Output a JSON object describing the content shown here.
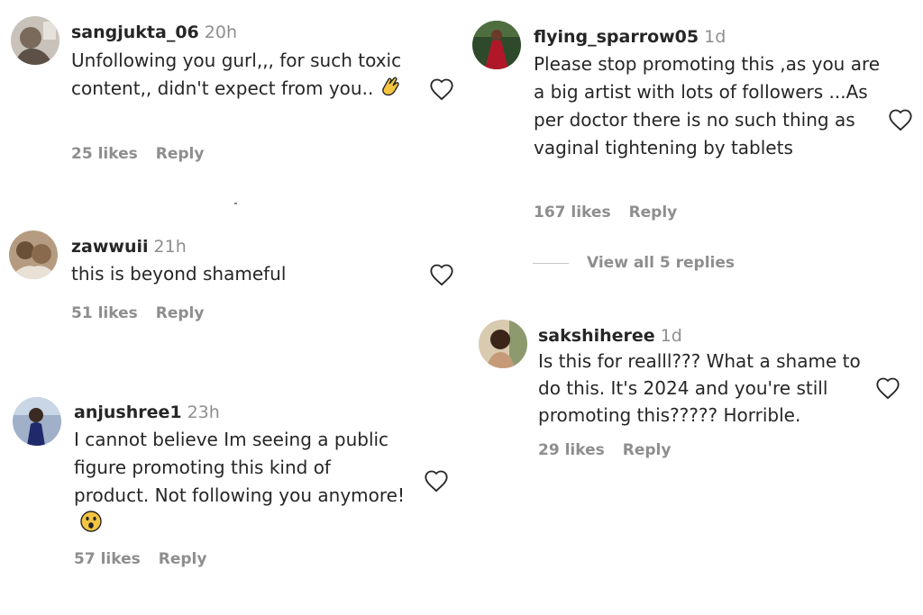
{
  "comments": [
    {
      "username": "sangjukta_06",
      "time": "20h",
      "text": "Unfollowing you gurl,,, for such toxic content,, didn't expect from you..",
      "emoji": "clapping-hands-icon",
      "likes": "25 likes",
      "reply": "Reply"
    },
    {
      "username": "zawwuii",
      "time": "21h",
      "text": "this is beyond shameful",
      "likes": "51 likes",
      "reply": "Reply"
    },
    {
      "username": "anjushree1",
      "time": "23h",
      "text": "I cannot believe Im seeing a public figure promoting this kind of product. Not following you anymore!",
      "emoji": "astonished-face-icon",
      "likes": "57 likes",
      "reply": "Reply"
    },
    {
      "username": "flying_sparrow05",
      "time": "1d",
      "text": "Please stop promoting this ,as you are a big artist with lots of followers ...As per doctor there is no such thing as vaginal tightening by tablets",
      "likes": "167 likes",
      "reply": "Reply",
      "view_replies": "View all 5 replies"
    },
    {
      "username": "sakshiheree",
      "time": "1d",
      "text": "Is this for realll??? What a shame to do this. It's 2024 and you're still promoting this????? Horrible.",
      "likes": "29 likes",
      "reply": "Reply"
    }
  ],
  "colors": {
    "text": "#262626",
    "secondary": "#8e8e8e",
    "heart_outline": "#262626",
    "background": "#ffffff"
  },
  "icons": {
    "like": "heart-outline-icon"
  }
}
